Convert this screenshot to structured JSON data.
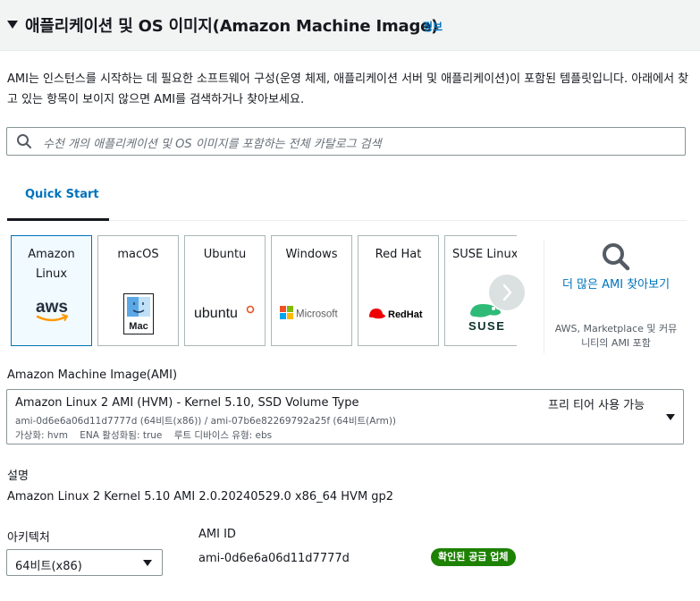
{
  "header": {
    "title": "애플리케이션 및 OS 이미지(Amazon Machine Image)",
    "info_link": "정보"
  },
  "description": "AMI는 인스턴스를 시작하는 데 필요한 소프트웨어 구성(운영 체제, 애플리케이션 서버 및 애플리케이션)이 포함된 템플릿입니다. 아래에서 찾고 있는 항목이 보이지 않으면 AMI를 검색하거나 찾아보세요.",
  "search": {
    "placeholder": "수천 개의 애플리케이션 및 OS 이미지를 포함하는 전체 카탈로그 검색",
    "icon": "search-icon"
  },
  "tabs": [
    {
      "label": "Quick Start",
      "active": true
    }
  ],
  "os_cards": [
    {
      "name": "Amazon Linux",
      "logo": "aws-logo",
      "selected": true
    },
    {
      "name": "macOS",
      "logo": "mac-finder-logo",
      "logo_text": "Mac",
      "selected": false
    },
    {
      "name": "Ubuntu",
      "logo": "ubuntu-logo",
      "logo_text": "ubuntu",
      "selected": false
    },
    {
      "name": "Windows",
      "logo": "microsoft-logo",
      "logo_text": "Microsoft",
      "selected": false
    },
    {
      "name": "Red Hat",
      "logo": "redhat-logo",
      "logo_text": "Red Hat",
      "selected": false
    },
    {
      "name": "SUSE Linux",
      "logo": "suse-logo",
      "logo_text": "SUSE",
      "selected": false
    }
  ],
  "browse_more": {
    "link": "더 많은 AMI 찾아보기",
    "subtext": "AWS, Marketplace 및 커뮤니티의 AMI 포함"
  },
  "ami_select": {
    "label": "Amazon Machine Image(AMI)",
    "name": "Amazon Linux 2 AMI (HVM) - Kernel 5.10, SSD Volume Type",
    "ids": "ami-0d6e6a06d11d7777d (64비트(x86)) / ami-07b6e82269792a25f (64비트(Arm))",
    "meta": "가상화: hvm    ENA 활성화됨: true    루트 디바이스 유형: ebs",
    "free_tier": "프리 티어 사용 가능"
  },
  "description_section": {
    "label": "설명",
    "value": "Amazon Linux 2 Kernel 5.10 AMI 2.0.20240529.0 x86_64 HVM gp2"
  },
  "architecture": {
    "label": "아키텍처",
    "value": "64비트(x86)"
  },
  "ami_id": {
    "label": "AMI ID",
    "value": "ami-0d6e6a06d11d7777d"
  },
  "verified_badge": "확인된 공급 업체",
  "colors": {
    "link": "#0073bb",
    "badge": "#1d8102",
    "aws_orange": "#ff9900",
    "ubuntu_orange": "#e95420",
    "redhat_red": "#ee0000",
    "suse_green": "#30ba78"
  }
}
